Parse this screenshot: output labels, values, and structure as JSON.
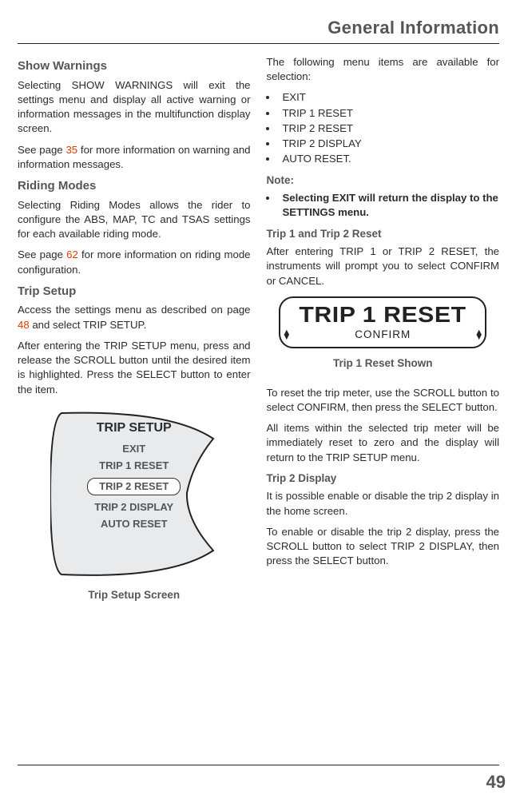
{
  "header": {
    "title": "General Information"
  },
  "left": {
    "show_warnings": {
      "heading": "Show Warnings",
      "p1": "Selecting SHOW WARNINGS will exit the settings menu and display all active warning or information messages in the multifunction display screen.",
      "p2a": "See page",
      "p2b": "35",
      "p2c": " for more information on warning and information messages."
    },
    "riding_modes": {
      "heading": "Riding Modes",
      "p1": "Selecting Riding Modes allows the rider to configure the ABS, MAP, TC and TSAS settings for each available riding mode.",
      "p2a": "See page",
      "p2b": "62",
      "p2c": " for more information on riding mode configuration."
    },
    "trip_setup": {
      "heading": "Trip Setup",
      "p1a": "Access the settings menu as described on page",
      "p1b": "48",
      "p1c": " and select TRIP SETUP.",
      "p2": "After entering the TRIP SETUP menu, press and release the SCROLL button until the desired item is highlighted. Press the SELECT button to enter the item."
    },
    "fig": {
      "title": "TRIP SETUP",
      "items": [
        "EXIT",
        "TRIP 1 RESET",
        "TRIP 2 RESET",
        "TRIP 2 DISPLAY",
        "AUTO RESET"
      ],
      "caption": "Trip Setup Screen"
    }
  },
  "right": {
    "intro": "The following menu items are available for selection:",
    "menu": [
      "EXIT",
      "TRIP 1 RESET",
      "TRIP 2 RESET",
      "TRIP 2 DISPLAY",
      "AUTO RESET."
    ],
    "note_heading": "Note:",
    "note_item": "Selecting EXIT will return the display to the SETTINGS menu.",
    "trip12_heading": "Trip 1 and Trip 2 Reset",
    "trip12_p": "After entering TRIP 1 or TRIP 2 RESET, the instruments will prompt you to select CONFIRM or CANCEL.",
    "reset_fig": {
      "title": "TRIP 1 RESET",
      "sub": "CONFIRM",
      "caption": "Trip 1 Reset Shown"
    },
    "reset_p1": "To reset the trip meter, use the SCROLL button to select CONFIRM, then press the SELECT button.",
    "reset_p2": "All items within the selected trip meter will be immediately reset to zero and the display will return to the TRIP SETUP menu.",
    "trip2d_heading": "Trip 2 Display",
    "trip2d_p1": "It is possible enable or disable the trip 2 display in the home screen.",
    "trip2d_p2": "To enable or disable the trip 2 display, press the SCROLL button to select TRIP 2 DISPLAY, then press the SELECT button."
  },
  "page_number": "49"
}
